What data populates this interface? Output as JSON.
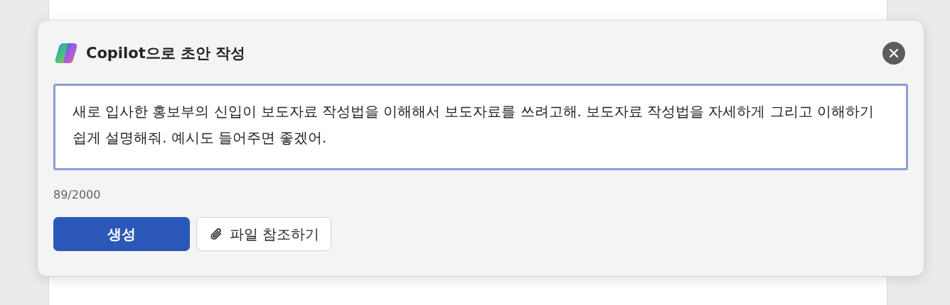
{
  "dialog": {
    "title": "Copilot으로 초안 작성",
    "prompt": {
      "value": "새로 입사한 홍보부의 신입이 보도자료 작성법을 이해해서 보도자료를 쓰려고해. 보도자료 작성법을 자세하게 그리고 이해하기 쉽게 설명해줘. 예시도 들어주면 좋겠어."
    },
    "counter": "89/2000",
    "buttons": [
      {
        "label": "생성",
        "kind": "primary"
      },
      {
        "label": "파일 참조하기",
        "kind": "attach"
      }
    ]
  }
}
